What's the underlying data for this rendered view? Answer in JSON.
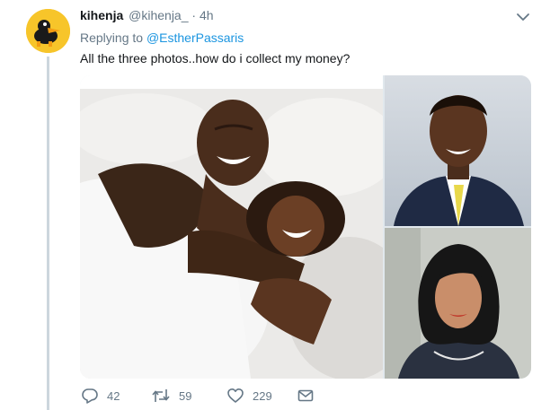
{
  "tweet": {
    "display_name": "kihenja",
    "handle": "@kihenja_",
    "separator": "·",
    "time": "4h",
    "replying_prefix": "Replying to",
    "replying_to": "@EstherPassaris",
    "text": "All the three photos..how do i collect my money?"
  },
  "actions": {
    "reply_count": "42",
    "retweet_count": "59",
    "like_count": "229"
  },
  "icons": {
    "avatar": "cartoon-duck-avatar",
    "caret": "chevron-down-icon",
    "reply": "reply-icon",
    "retweet": "retweet-icon",
    "like": "heart-icon",
    "dm": "envelope-icon"
  },
  "colors": {
    "link": "#1b95e0",
    "muted": "#657786",
    "avatar_bg": "#f7c52a"
  }
}
